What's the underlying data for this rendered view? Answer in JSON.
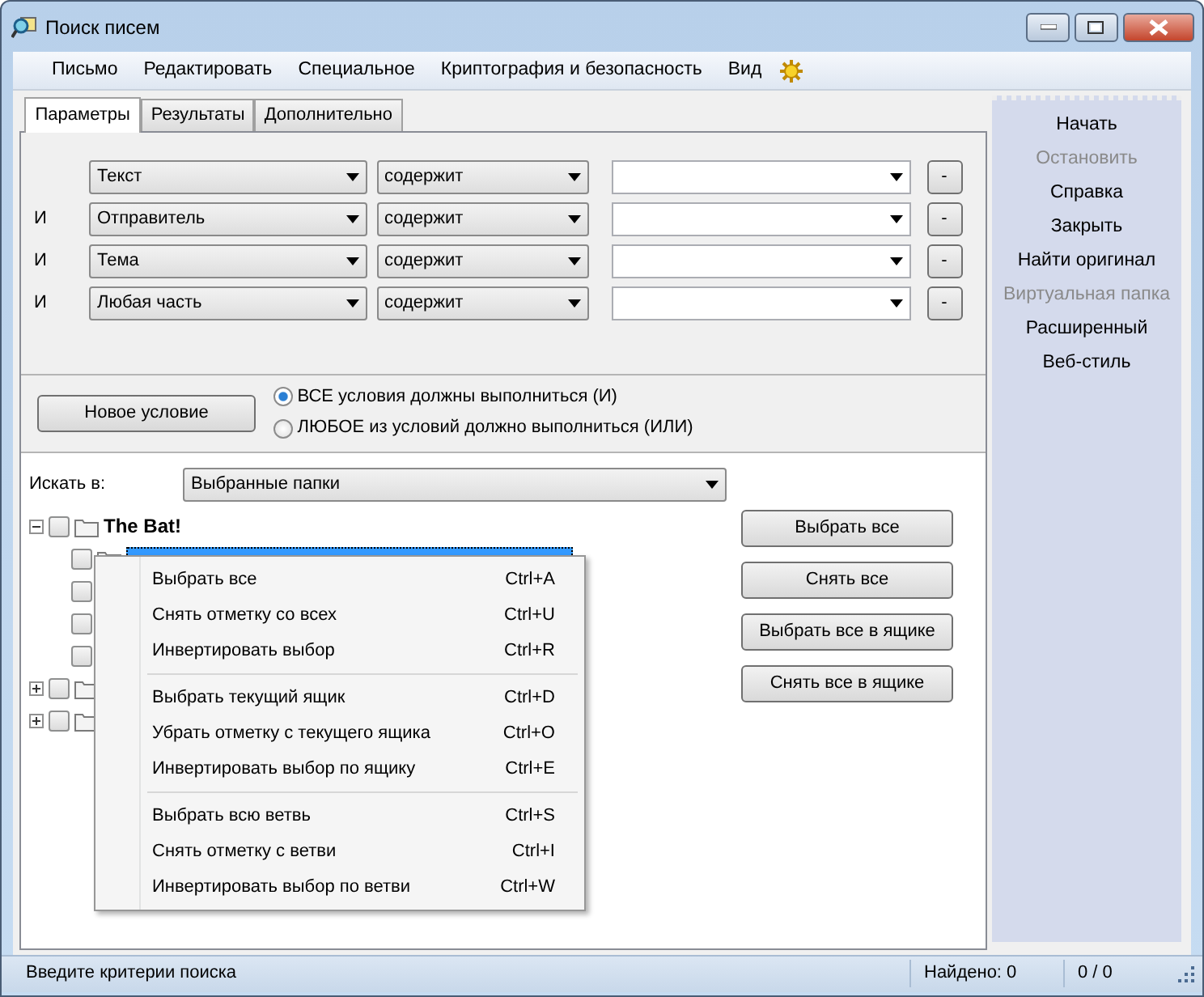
{
  "window": {
    "title": "Поиск писем"
  },
  "menu": [
    {
      "label": "Письмо"
    },
    {
      "label": "Редактировать"
    },
    {
      "label": "Специальное"
    },
    {
      "label": "Криптография и безопасность"
    },
    {
      "label": "Вид"
    }
  ],
  "tabs": [
    {
      "label": "Параметры",
      "selected": true
    },
    {
      "label": "Результаты",
      "selected": false
    },
    {
      "label": "Дополнительно",
      "selected": false
    }
  ],
  "conditions": [
    {
      "field": "Текст",
      "operator": "содержит",
      "button": "-"
    },
    {
      "connector": "И",
      "field": "Отправитель",
      "operator": "содержит",
      "button": "-"
    },
    {
      "connector": "И",
      "field": "Тема",
      "operator": "содержит",
      "button": "-"
    },
    {
      "connector": "И",
      "field": "Любая часть",
      "operator": "содержит",
      "button": "-"
    }
  ],
  "new_condition_button": "Новое условие",
  "match_mode": [
    {
      "label": "ВСЕ условия должны выполниться (И)",
      "selected": true
    },
    {
      "label": "ЛЮБОЕ из условий должно выполниться (ИЛИ)",
      "selected": false
    }
  ],
  "search_in": {
    "label": "Искать в:",
    "value": "Выбранные папки"
  },
  "tree": [
    {
      "label": "The Bat!",
      "checked": false,
      "expanded": true,
      "selected": false,
      "children": [
        {
          "checked": false,
          "selected": true
        },
        {
          "checked": false,
          "selected": false
        },
        {
          "checked": false,
          "selected": false
        },
        {
          "checked": false,
          "selected": false
        }
      ]
    },
    {
      "checked": false,
      "expanded": false,
      "selected": false
    },
    {
      "checked": false,
      "expanded": false,
      "selected": false
    }
  ],
  "tree_buttons": [
    "Выбрать все",
    "Снять все",
    "Выбрать все в ящике",
    "Снять все в ящике"
  ],
  "sidebar": [
    {
      "label": "Начать",
      "disabled": false
    },
    {
      "label": "Остановить",
      "disabled": true
    },
    {
      "label": "Справка",
      "disabled": false
    },
    {
      "label": "Закрыть",
      "disabled": false
    },
    {
      "label": "Найти оригинал",
      "disabled": false
    },
    {
      "label": "Виртуальная папка",
      "disabled": true
    },
    {
      "label": "Расширенный",
      "disabled": false
    },
    {
      "label": "Веб-стиль",
      "disabled": false
    }
  ],
  "context_menu": [
    [
      {
        "label": "Выбрать все",
        "shortcut": "Ctrl+A"
      },
      {
        "label": "Снять отметку со всех",
        "shortcut": "Ctrl+U"
      },
      {
        "label": "Инвертировать выбор",
        "shortcut": "Ctrl+R"
      }
    ],
    [
      {
        "label": "Выбрать текущий ящик",
        "shortcut": "Ctrl+D"
      },
      {
        "label": "Убрать отметку с текущего ящика",
        "shortcut": "Ctrl+O"
      },
      {
        "label": "Инвертировать выбор по ящику",
        "shortcut": "Ctrl+E"
      }
    ],
    [
      {
        "label": "Выбрать всю ветвь",
        "shortcut": "Ctrl+S"
      },
      {
        "label": "Снять отметку с ветви",
        "shortcut": "Ctrl+I"
      },
      {
        "label": "Инвертировать выбор по ветви",
        "shortcut": "Ctrl+W"
      }
    ]
  ],
  "status_bar": {
    "message": "Введите критерии поиска",
    "found": "Найдено: 0",
    "counter": "0 / 0"
  }
}
